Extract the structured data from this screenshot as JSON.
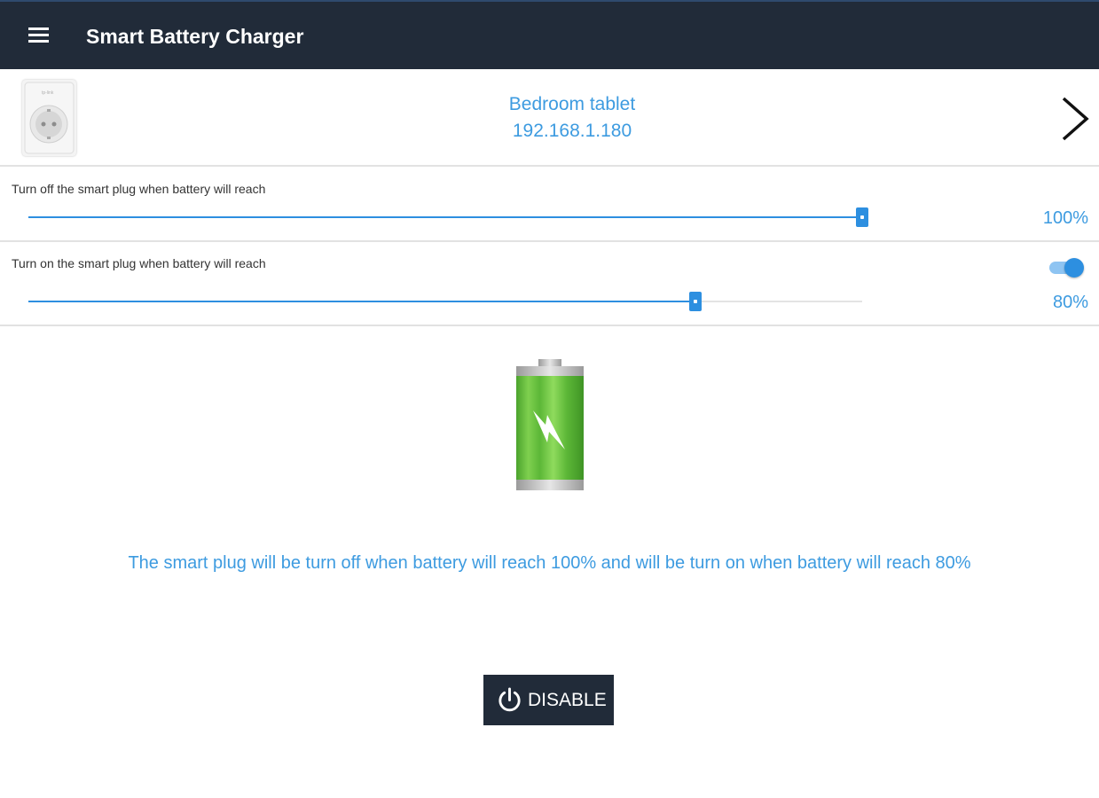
{
  "app_bar": {
    "title": "Smart Battery Charger",
    "menu_icon": "menu-icon",
    "background_color": "#212b39"
  },
  "device": {
    "name": "Bedroom tablet",
    "ip": "192.168.1.180",
    "thumbnail_icon": "smart-plug-icon",
    "nav_icon": "chevron-right-icon"
  },
  "turn_off": {
    "label": "Turn off the smart plug when battery will reach",
    "value_percent": 100,
    "value_label": "100%"
  },
  "turn_on": {
    "label": "Turn on the smart plug when battery will reach",
    "value_percent": 80,
    "value_label": "80%",
    "toggle_on": true
  },
  "battery": {
    "icon": "battery-charging-icon",
    "color": "#6cc644"
  },
  "status": {
    "message": "The smart plug will be turn off when battery will reach 100% and  will be turn on when battery will reach 80%"
  },
  "disable_button": {
    "label": "DISABLE",
    "icon": "power-icon"
  },
  "accent_color": "#3d9be0"
}
